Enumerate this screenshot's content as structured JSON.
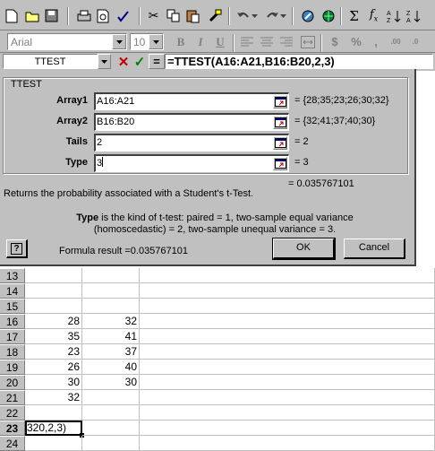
{
  "formatting": {
    "font_name": "Arial",
    "font_size": "10"
  },
  "formula_bar": {
    "name_box": "TTEST",
    "cancel_symbol": "✕",
    "enter_symbol": "✓",
    "equals_symbol": "=",
    "formula": "=TTEST(A16:A21,B16:B20,2,3)"
  },
  "dialog": {
    "group_title": "TTEST",
    "arguments": [
      {
        "label": "Array1",
        "value": "A16:A21",
        "result": "= {28;35;23;26;30;32}"
      },
      {
        "label": "Array2",
        "value": "B16:B20",
        "result": "= {32;41;37;40;30}"
      },
      {
        "label": "Tails",
        "value": "2",
        "result": "= 2"
      },
      {
        "label": "Type",
        "value": "3",
        "result": "= 3"
      }
    ],
    "formula_value": "= 0.035767101",
    "description": "Returns the probability associated with a Student's t-Test.",
    "arg_help_name": "Type",
    "arg_help_line1": " is the kind of t-test: paired = 1, two-sample equal variance",
    "arg_help_line2": "(homoscedastic) = 2, two-sample unequal variance = 3.",
    "help_symbol": "?",
    "formula_result": "Formula result =0.035767101",
    "ok_label": "OK",
    "cancel_label": "Cancel"
  },
  "sheet": {
    "rows": [
      {
        "num": "13",
        "a": "",
        "b": ""
      },
      {
        "num": "14",
        "a": "",
        "b": ""
      },
      {
        "num": "15",
        "a": "",
        "b": ""
      },
      {
        "num": "16",
        "a": "28",
        "b": "32"
      },
      {
        "num": "17",
        "a": "35",
        "b": "41"
      },
      {
        "num": "18",
        "a": "23",
        "b": "37"
      },
      {
        "num": "19",
        "a": "26",
        "b": "40"
      },
      {
        "num": "20",
        "a": "30",
        "b": "30"
      },
      {
        "num": "21",
        "a": "32",
        "b": ""
      },
      {
        "num": "22",
        "a": "",
        "b": ""
      },
      {
        "num": "23",
        "a": "320,2,3)",
        "b": ""
      },
      {
        "num": "24",
        "a": "",
        "b": ""
      }
    ]
  }
}
